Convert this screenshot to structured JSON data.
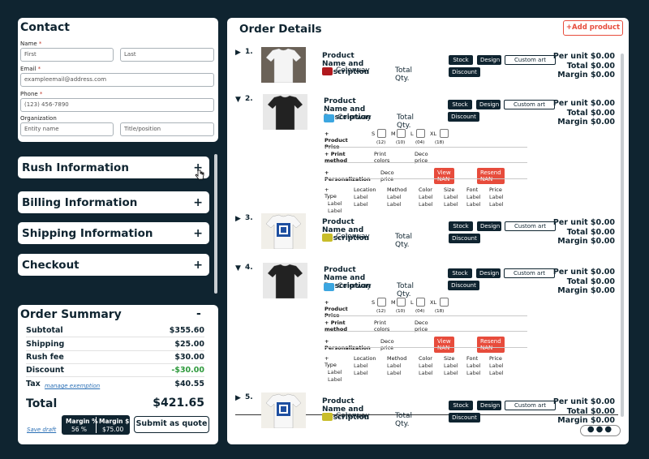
{
  "contact": {
    "title": "Contact",
    "name_label": "Name",
    "first_ph": "First",
    "last_ph": "Last",
    "email_label": "Email",
    "email_ph": "exampleemail@address.com",
    "phone_label": "Phone",
    "phone_ph": "(123) 456-7890",
    "org_label": "Organization",
    "entity_ph": "Entity name",
    "title_ph": "Title/position",
    "req": "*"
  },
  "accordions": {
    "rush": "Rush Information",
    "billing": "Billing Information",
    "shipping": "Shipping Information",
    "checkout": "Checkout",
    "plus": "+"
  },
  "summary": {
    "title": "Order Summary",
    "collapse": "-",
    "rows": [
      {
        "label": "Subtotal",
        "value": "$355.60"
      },
      {
        "label": "Shipping",
        "value": "$25.00"
      },
      {
        "label": "Rush fee",
        "value": "$30.00"
      },
      {
        "label": "Discount",
        "value": "-$30.00"
      },
      {
        "label": "Tax",
        "value": "$40.55"
      }
    ],
    "manage": "manage exemption",
    "total_label": "Total",
    "total_value": "$421.65",
    "save_draft": "Save draft",
    "margin_pct_label": "Margin %",
    "margin_pct": "56 %",
    "margin_amt_label": "Margin $",
    "margin_amt": "$75.00",
    "submit": "Submit as quote",
    "discount_color": "#2e9a3c"
  },
  "order": {
    "title": "Order Details",
    "add": "+Add product",
    "pname": "Product Name and Description",
    "colorway": "Colorway",
    "total_qty": "Total Qty.",
    "stock": "Stock",
    "design": "Design",
    "custom_art": "Custom art",
    "discount": "Discount",
    "per_unit": "Per unit $0.00",
    "total": "Total $0.00",
    "margin": "Margin $0.00",
    "product_price": "+ Product Price",
    "print_method": "+ Print method",
    "print_colors": "Print colors",
    "deco_price": "Deco price",
    "personalization": "+ Personalization",
    "view_nan": "View NAN",
    "resend_nan": "Resend NAN",
    "sizes": [
      {
        "s": "S",
        "q": "(12)"
      },
      {
        "s": "M",
        "q": "(10)"
      },
      {
        "s": "L",
        "q": "(04)"
      },
      {
        "s": "XL",
        "q": "(18)"
      }
    ],
    "table_headers": [
      "+ Type",
      "Location",
      "Method",
      "Color",
      "Size",
      "Font",
      "Price"
    ],
    "table_row": [
      "- Label",
      "Label",
      "Label",
      "Label",
      "Label",
      "Label",
      "Label"
    ],
    "items": [
      {
        "num": "1.",
        "swatch": "#b0191e"
      },
      {
        "num": "2.",
        "swatch": "#3ca6e0"
      },
      {
        "num": "3.",
        "swatch": "#c8bd2a"
      },
      {
        "num": "4.",
        "swatch": "#3ca6e0"
      },
      {
        "num": "5.",
        "swatch": "#c8bd2a"
      }
    ]
  },
  "colors": {
    "navy": "#0f2430",
    "red": "#e74c3c"
  },
  "icons": {
    "expand": "triangle-right-icon",
    "collapse": "triangle-down-icon",
    "more": "more-dots-icon"
  }
}
